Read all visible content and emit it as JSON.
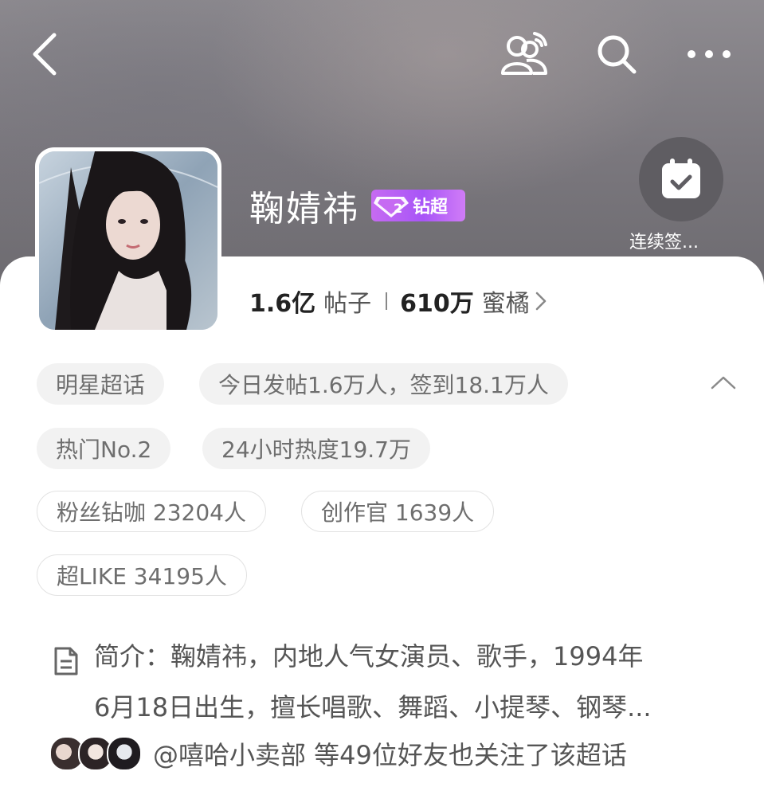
{
  "topbar": {
    "back_icon": "chevron-left-icon",
    "friends_icon": "friends-icon",
    "search_icon": "search-icon",
    "more_icon": "more-icon"
  },
  "topic": {
    "name": "鞠婧祎",
    "badge_level": "2",
    "badge_label": "钻超",
    "posts_count": "1.6亿",
    "posts_unit": "帖子",
    "fans_count": "610万",
    "fans_unit": "蜜橘",
    "checkin_label": "连续签..."
  },
  "chips": [
    "明星超话",
    "今日发帖1.6万人，签到18.1万人",
    "热门No.2",
    "24小时热度19.7万",
    "粉丝钻咖 23204人",
    "创作官 1639人",
    "超LIKE 34195人"
  ],
  "intro": {
    "line1": "简介：鞠婧祎，内地人气女演员、歌手，1994年",
    "line2": "6月18日出生，擅长唱歌、舞蹈、小提琴、钢琴..."
  },
  "friends": {
    "text": "@嘻哈小卖部 等49位好友也关注了该超话"
  },
  "colors": {
    "badge": "#a855f7",
    "chip_bg": "#f2f2f2",
    "chip_text": "#6e6e6e"
  }
}
